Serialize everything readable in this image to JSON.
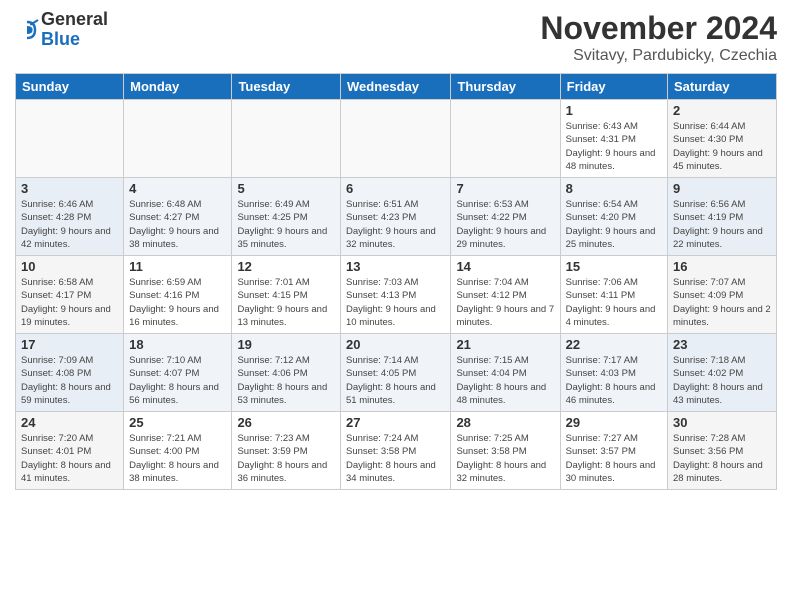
{
  "header": {
    "logo_line1": "General",
    "logo_line2": "Blue",
    "month_title": "November 2024",
    "subtitle": "Svitavy, Pardubicky, Czechia"
  },
  "weekdays": [
    "Sunday",
    "Monday",
    "Tuesday",
    "Wednesday",
    "Thursday",
    "Friday",
    "Saturday"
  ],
  "weeks": [
    [
      {
        "day": "",
        "info": ""
      },
      {
        "day": "",
        "info": ""
      },
      {
        "day": "",
        "info": ""
      },
      {
        "day": "",
        "info": ""
      },
      {
        "day": "",
        "info": ""
      },
      {
        "day": "1",
        "info": "Sunrise: 6:43 AM\nSunset: 4:31 PM\nDaylight: 9 hours and 48 minutes."
      },
      {
        "day": "2",
        "info": "Sunrise: 6:44 AM\nSunset: 4:30 PM\nDaylight: 9 hours and 45 minutes."
      }
    ],
    [
      {
        "day": "3",
        "info": "Sunrise: 6:46 AM\nSunset: 4:28 PM\nDaylight: 9 hours and 42 minutes."
      },
      {
        "day": "4",
        "info": "Sunrise: 6:48 AM\nSunset: 4:27 PM\nDaylight: 9 hours and 38 minutes."
      },
      {
        "day": "5",
        "info": "Sunrise: 6:49 AM\nSunset: 4:25 PM\nDaylight: 9 hours and 35 minutes."
      },
      {
        "day": "6",
        "info": "Sunrise: 6:51 AM\nSunset: 4:23 PM\nDaylight: 9 hours and 32 minutes."
      },
      {
        "day": "7",
        "info": "Sunrise: 6:53 AM\nSunset: 4:22 PM\nDaylight: 9 hours and 29 minutes."
      },
      {
        "day": "8",
        "info": "Sunrise: 6:54 AM\nSunset: 4:20 PM\nDaylight: 9 hours and 25 minutes."
      },
      {
        "day": "9",
        "info": "Sunrise: 6:56 AM\nSunset: 4:19 PM\nDaylight: 9 hours and 22 minutes."
      }
    ],
    [
      {
        "day": "10",
        "info": "Sunrise: 6:58 AM\nSunset: 4:17 PM\nDaylight: 9 hours and 19 minutes."
      },
      {
        "day": "11",
        "info": "Sunrise: 6:59 AM\nSunset: 4:16 PM\nDaylight: 9 hours and 16 minutes."
      },
      {
        "day": "12",
        "info": "Sunrise: 7:01 AM\nSunset: 4:15 PM\nDaylight: 9 hours and 13 minutes."
      },
      {
        "day": "13",
        "info": "Sunrise: 7:03 AM\nSunset: 4:13 PM\nDaylight: 9 hours and 10 minutes."
      },
      {
        "day": "14",
        "info": "Sunrise: 7:04 AM\nSunset: 4:12 PM\nDaylight: 9 hours and 7 minutes."
      },
      {
        "day": "15",
        "info": "Sunrise: 7:06 AM\nSunset: 4:11 PM\nDaylight: 9 hours and 4 minutes."
      },
      {
        "day": "16",
        "info": "Sunrise: 7:07 AM\nSunset: 4:09 PM\nDaylight: 9 hours and 2 minutes."
      }
    ],
    [
      {
        "day": "17",
        "info": "Sunrise: 7:09 AM\nSunset: 4:08 PM\nDaylight: 8 hours and 59 minutes."
      },
      {
        "day": "18",
        "info": "Sunrise: 7:10 AM\nSunset: 4:07 PM\nDaylight: 8 hours and 56 minutes."
      },
      {
        "day": "19",
        "info": "Sunrise: 7:12 AM\nSunset: 4:06 PM\nDaylight: 8 hours and 53 minutes."
      },
      {
        "day": "20",
        "info": "Sunrise: 7:14 AM\nSunset: 4:05 PM\nDaylight: 8 hours and 51 minutes."
      },
      {
        "day": "21",
        "info": "Sunrise: 7:15 AM\nSunset: 4:04 PM\nDaylight: 8 hours and 48 minutes."
      },
      {
        "day": "22",
        "info": "Sunrise: 7:17 AM\nSunset: 4:03 PM\nDaylight: 8 hours and 46 minutes."
      },
      {
        "day": "23",
        "info": "Sunrise: 7:18 AM\nSunset: 4:02 PM\nDaylight: 8 hours and 43 minutes."
      }
    ],
    [
      {
        "day": "24",
        "info": "Sunrise: 7:20 AM\nSunset: 4:01 PM\nDaylight: 8 hours and 41 minutes."
      },
      {
        "day": "25",
        "info": "Sunrise: 7:21 AM\nSunset: 4:00 PM\nDaylight: 8 hours and 38 minutes."
      },
      {
        "day": "26",
        "info": "Sunrise: 7:23 AM\nSunset: 3:59 PM\nDaylight: 8 hours and 36 minutes."
      },
      {
        "day": "27",
        "info": "Sunrise: 7:24 AM\nSunset: 3:58 PM\nDaylight: 8 hours and 34 minutes."
      },
      {
        "day": "28",
        "info": "Sunrise: 7:25 AM\nSunset: 3:58 PM\nDaylight: 8 hours and 32 minutes."
      },
      {
        "day": "29",
        "info": "Sunrise: 7:27 AM\nSunset: 3:57 PM\nDaylight: 8 hours and 30 minutes."
      },
      {
        "day": "30",
        "info": "Sunrise: 7:28 AM\nSunset: 3:56 PM\nDaylight: 8 hours and 28 minutes."
      }
    ]
  ]
}
